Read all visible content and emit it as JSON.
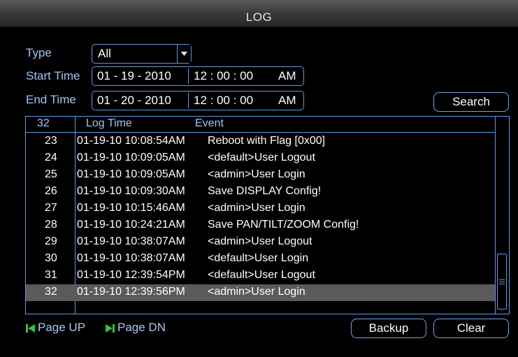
{
  "window": {
    "title": "LOG"
  },
  "filters": {
    "type_label": "Type",
    "type_value": "All",
    "start_label": "Start Time",
    "start_date": "01 - 19 - 2010",
    "start_time": "12 : 00 : 00",
    "start_ampm": "AM",
    "end_label": "End Time",
    "end_date": "01 - 20 - 2010",
    "end_time": "12 : 00 : 00",
    "end_ampm": "AM",
    "search_label": "Search"
  },
  "table": {
    "count": "32",
    "col_time": "Log Time",
    "col_event": "Event",
    "rows": [
      {
        "num": "23",
        "time": "01-19-10 10:08:54AM",
        "event": "Reboot with Flag [0x00]"
      },
      {
        "num": "24",
        "time": "01-19-10 10:09:05AM",
        "event": "<default>User Logout"
      },
      {
        "num": "25",
        "time": "01-19-10 10:09:05AM",
        "event": "<admin>User Login"
      },
      {
        "num": "26",
        "time": "01-19-10 10:09:30AM",
        "event": "Save DISPLAY Config!"
      },
      {
        "num": "27",
        "time": "01-19-10 10:15:46AM",
        "event": "<admin>User Login"
      },
      {
        "num": "28",
        "time": "01-19-10 10:24:21AM",
        "event": "Save PAN/TILT/ZOOM Config!"
      },
      {
        "num": "29",
        "time": "01-19-10 10:38:07AM",
        "event": "<admin>User Logout"
      },
      {
        "num": "30",
        "time": "01-19-10 10:38:07AM",
        "event": "<default>User Login"
      },
      {
        "num": "31",
        "time": "01-19-10 12:39:54PM",
        "event": "<default>User Logout"
      },
      {
        "num": "32",
        "time": "01-19-10 12:39:56PM",
        "event": "<admin>User Login"
      }
    ],
    "selected_num": "32"
  },
  "footer": {
    "page_up": "Page UP",
    "page_dn": "Page DN",
    "backup": "Backup",
    "clear": "Clear"
  },
  "colors": {
    "accent": "#5c9ae0",
    "label": "#9fc4ee",
    "green_icon": "#2ec43a",
    "selected_row": "#5a5a5a"
  },
  "icons": {
    "page_up": "skip-back-icon",
    "page_dn": "skip-forward-icon",
    "type_dropdown": "chevron-down-icon"
  }
}
